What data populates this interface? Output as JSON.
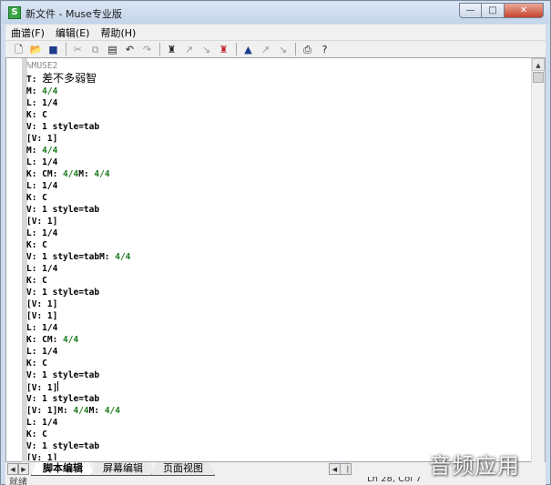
{
  "window": {
    "title": "新文件 - Muse专业版",
    "app_icon_glyph": "S",
    "controls": {
      "minimize": "—",
      "maximize": "□",
      "close": "✕"
    }
  },
  "menu": {
    "items": [
      "曲谱(F)",
      "编辑(E)",
      "帮助(H)"
    ]
  },
  "toolbar": {
    "icons": [
      "new-file-icon",
      "open-folder-icon",
      "save-disk-icon",
      "cut-scissors-icon",
      "copy-icon",
      "paste-icon",
      "undo-icon",
      "redo-icon",
      "find-binoculars-icon",
      "find-next-icon",
      "find-prev-icon",
      "replace-binoculars-icon",
      "tool-1-icon",
      "tool-2-icon",
      "tool-3-icon",
      "print-icon",
      "help-icon"
    ]
  },
  "editor": {
    "lines": [
      [
        {
          "t": "%MUSE2",
          "c": "gray"
        }
      ],
      [
        {
          "t": "T: ",
          "c": "k"
        },
        {
          "t": "差不多弱智",
          "c": "cjk"
        }
      ],
      [
        {
          "t": "M: ",
          "c": "k"
        },
        {
          "t": "4/4",
          "c": "v"
        }
      ],
      [
        {
          "t": "L: 1/4",
          "c": "k"
        }
      ],
      [
        {
          "t": "K: C",
          "c": "k"
        }
      ],
      [
        {
          "t": "V: 1 style=tab",
          "c": "k"
        }
      ],
      [
        {
          "t": "[V: 1]",
          "c": "k"
        }
      ],
      [
        {
          "t": "M: ",
          "c": "k"
        },
        {
          "t": "4/4",
          "c": "v"
        }
      ],
      [
        {
          "t": "L: 1/4",
          "c": "k"
        }
      ],
      [
        {
          "t": "K: CM: ",
          "c": "k"
        },
        {
          "t": "4/4",
          "c": "v"
        },
        {
          "t": "M: ",
          "c": "k"
        },
        {
          "t": "4/4",
          "c": "v"
        }
      ],
      [
        {
          "t": "L: 1/4",
          "c": "k"
        }
      ],
      [
        {
          "t": "K: C",
          "c": "k"
        }
      ],
      [
        {
          "t": "V: 1 style=tab",
          "c": "k"
        }
      ],
      [
        {
          "t": "[V: 1]",
          "c": "k"
        }
      ],
      [
        {
          "t": "L: 1/4",
          "c": "k"
        }
      ],
      [
        {
          "t": "K: C",
          "c": "k"
        }
      ],
      [
        {
          "t": "V: 1 style=tabM: ",
          "c": "k"
        },
        {
          "t": "4/4",
          "c": "v"
        }
      ],
      [
        {
          "t": "L: 1/4",
          "c": "k"
        }
      ],
      [
        {
          "t": "K: C",
          "c": "k"
        }
      ],
      [
        {
          "t": "V: 1 style=tab",
          "c": "k"
        }
      ],
      [
        {
          "t": "[V: 1]",
          "c": "k"
        }
      ],
      [
        {
          "t": "[V: 1]",
          "c": "k"
        }
      ],
      [
        {
          "t": "L: 1/4",
          "c": "k"
        }
      ],
      [
        {
          "t": "K: CM: ",
          "c": "k"
        },
        {
          "t": "4/4",
          "c": "v"
        }
      ],
      [
        {
          "t": "L: 1/4",
          "c": "k"
        }
      ],
      [
        {
          "t": "K: C",
          "c": "k"
        }
      ],
      [
        {
          "t": "V: 1 style=tab",
          "c": "k"
        }
      ],
      [
        {
          "t": "[V: 1]",
          "c": "k"
        },
        {
          "t": "",
          "c": "caret"
        }
      ],
      [
        {
          "t": "V: 1 style=tab",
          "c": "k"
        }
      ],
      [
        {
          "t": "[V: 1]M: ",
          "c": "k"
        },
        {
          "t": "4/4",
          "c": "v"
        },
        {
          "t": "M: ",
          "c": "k"
        },
        {
          "t": "4/4",
          "c": "v"
        }
      ],
      [
        {
          "t": "L: 1/4",
          "c": "k"
        }
      ],
      [
        {
          "t": "K: C",
          "c": "k"
        }
      ],
      [
        {
          "t": "V: 1 style=tab",
          "c": "k"
        }
      ],
      [
        {
          "t": "[V: 1]",
          "c": "k"
        }
      ]
    ]
  },
  "tabs": [
    {
      "label": "脚本编辑",
      "active": true
    },
    {
      "label": "屏幕编辑",
      "active": false
    },
    {
      "label": "页面视图",
      "active": false
    }
  ],
  "statusbar": {
    "left": "就绪",
    "position": "Ln 28, Col 7"
  },
  "watermark": "音频应用"
}
